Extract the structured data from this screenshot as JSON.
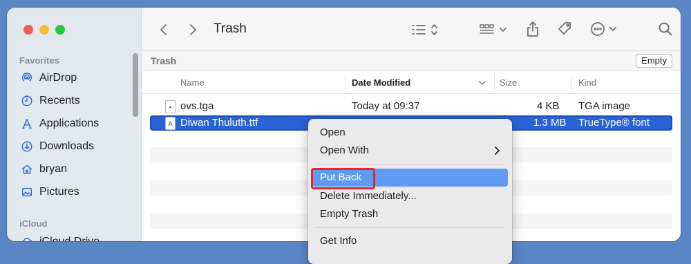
{
  "window": {
    "title": "Trash",
    "traffic_lights": [
      "#ee5f57",
      "#f5bd2f",
      "#28c840"
    ]
  },
  "sidebar": {
    "sections": [
      {
        "label": "Favorites",
        "items": [
          {
            "label": "AirDrop",
            "icon": "airdrop-icon"
          },
          {
            "label": "Recents",
            "icon": "clock-icon"
          },
          {
            "label": "Applications",
            "icon": "applications-icon"
          },
          {
            "label": "Downloads",
            "icon": "download-icon"
          },
          {
            "label": "bryan",
            "icon": "home-icon"
          },
          {
            "label": "Pictures",
            "icon": "photo-icon"
          }
        ]
      },
      {
        "label": "iCloud",
        "items": [
          {
            "label": "iCloud Drive",
            "icon": "cloud-icon"
          }
        ]
      }
    ]
  },
  "toolbar": {
    "icons": [
      "back-icon",
      "forward-icon",
      "list-view-icon",
      "group-icon",
      "share-icon",
      "tag-icon",
      "more-icon",
      "search-icon"
    ]
  },
  "pathbar": {
    "title": "Trash",
    "empty_label": "Empty"
  },
  "columns": {
    "name": "Name",
    "date": "Date Modified",
    "size": "Size",
    "kind": "Kind"
  },
  "files": [
    {
      "name": "ovs.tga",
      "date": "Today at 09:37",
      "size": "4 KB",
      "kind": "TGA image",
      "selected": false
    },
    {
      "name": "Diwan Thuluth.ttf",
      "date": "",
      "size": "1.3 MB",
      "kind": "TrueType® font",
      "selected": true
    }
  ],
  "context_menu": {
    "items": [
      "Open",
      "Open With",
      "Put Back",
      "Delete Immediately...",
      "Empty Trash",
      "Get Info"
    ],
    "highlighted": "Put Back"
  },
  "colors": {
    "selection": "#2a63d6",
    "menu_highlight": "#5f9cf1",
    "annotation": "#e0262e"
  }
}
